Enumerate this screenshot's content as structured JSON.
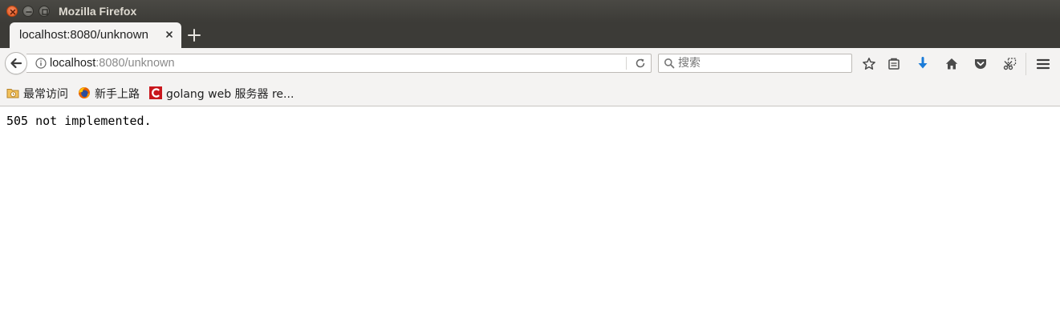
{
  "window": {
    "title": "Mozilla Firefox"
  },
  "tab": {
    "title": "localhost:8080/unknown"
  },
  "urlbar": {
    "host": "localhost",
    "rest": ":8080/unknown"
  },
  "searchbar": {
    "placeholder": "搜索"
  },
  "bookmarks": [
    {
      "label": "最常访问",
      "icon": "folder-clock-icon"
    },
    {
      "label": "新手上路",
      "icon": "firefox-icon"
    },
    {
      "label": "golang web 服务器 re...",
      "icon": "csdn-c-icon"
    }
  ],
  "page": {
    "body_text": "505 not implemented."
  },
  "colors": {
    "titlebar": "#3c3b37",
    "toolbar": "#f4f3f2",
    "close_button": "#e1531a",
    "download_arrow": "#1a7bd8"
  }
}
